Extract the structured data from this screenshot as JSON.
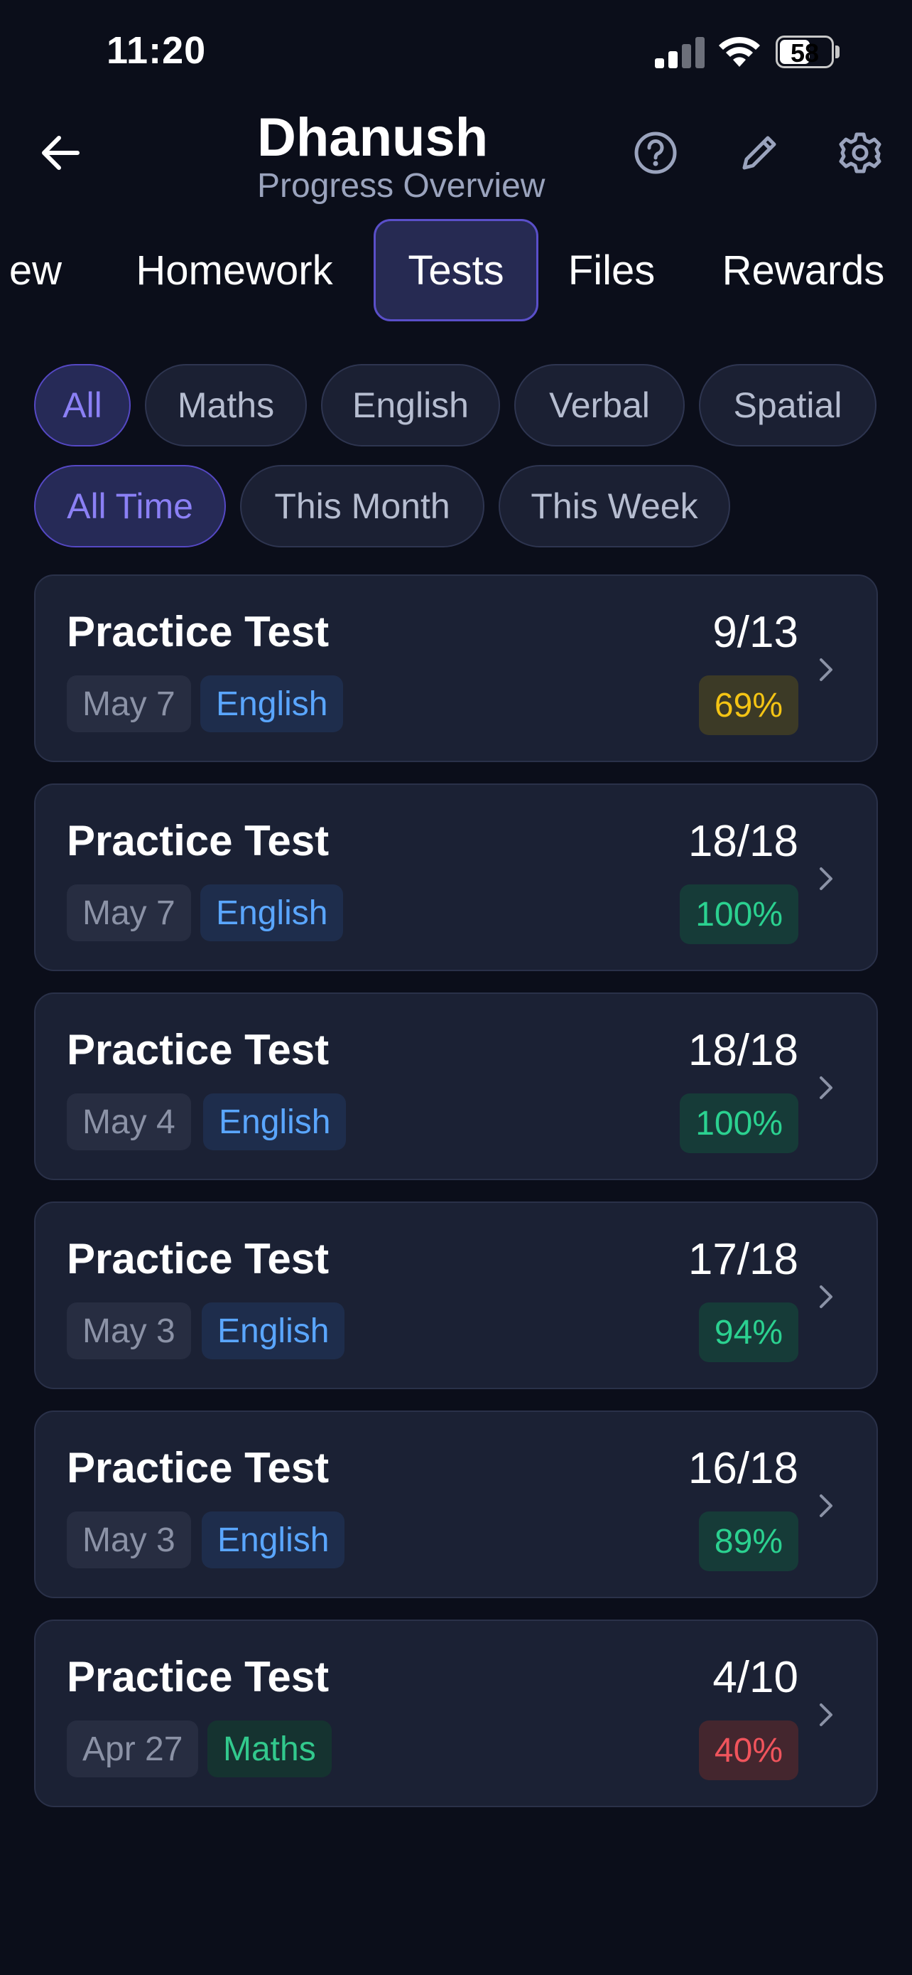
{
  "status_bar": {
    "time": "11:20",
    "battery": "58"
  },
  "header": {
    "title": "Dhanush",
    "subtitle": "Progress Overview"
  },
  "tabs": [
    {
      "label": "ew"
    },
    {
      "label": "Homework"
    },
    {
      "label": "Tests"
    },
    {
      "label": "Files"
    },
    {
      "label": "Rewards"
    }
  ],
  "subject_filters": [
    {
      "label": "All"
    },
    {
      "label": "Maths"
    },
    {
      "label": "English"
    },
    {
      "label": "Verbal"
    },
    {
      "label": "Spatial"
    }
  ],
  "time_filters": [
    {
      "label": "All Time"
    },
    {
      "label": "This Month"
    },
    {
      "label": "This Week"
    }
  ],
  "tests": [
    {
      "title": "Practice Test",
      "date": "May 7",
      "subject": "English",
      "score": "9/13",
      "percent": "69%"
    },
    {
      "title": "Practice Test",
      "date": "May 7",
      "subject": "English",
      "score": "18/18",
      "percent": "100%"
    },
    {
      "title": "Practice Test",
      "date": "May 4",
      "subject": "English",
      "score": "18/18",
      "percent": "100%"
    },
    {
      "title": "Practice Test",
      "date": "May 3",
      "subject": "English",
      "score": "17/18",
      "percent": "94%"
    },
    {
      "title": "Practice Test",
      "date": "May 3",
      "subject": "English",
      "score": "16/18",
      "percent": "89%"
    },
    {
      "title": "Practice Test",
      "date": "Apr 27",
      "subject": "Maths",
      "score": "4/10",
      "percent": "40%"
    }
  ],
  "icons": {
    "back": "arrow-left-icon",
    "help": "question-circle-icon",
    "edit": "pencil-icon",
    "settings": "gear-icon",
    "row": "chevron-right-icon"
  },
  "colors": {
    "background": "#0b0e1a",
    "card": "#1b2134",
    "accent": "#8b80f5",
    "english": "#5aa6ff",
    "maths": "#32c98d",
    "score_yellow": "#f4c414",
    "score_green": "#2bd190",
    "score_red": "#f0545c"
  }
}
